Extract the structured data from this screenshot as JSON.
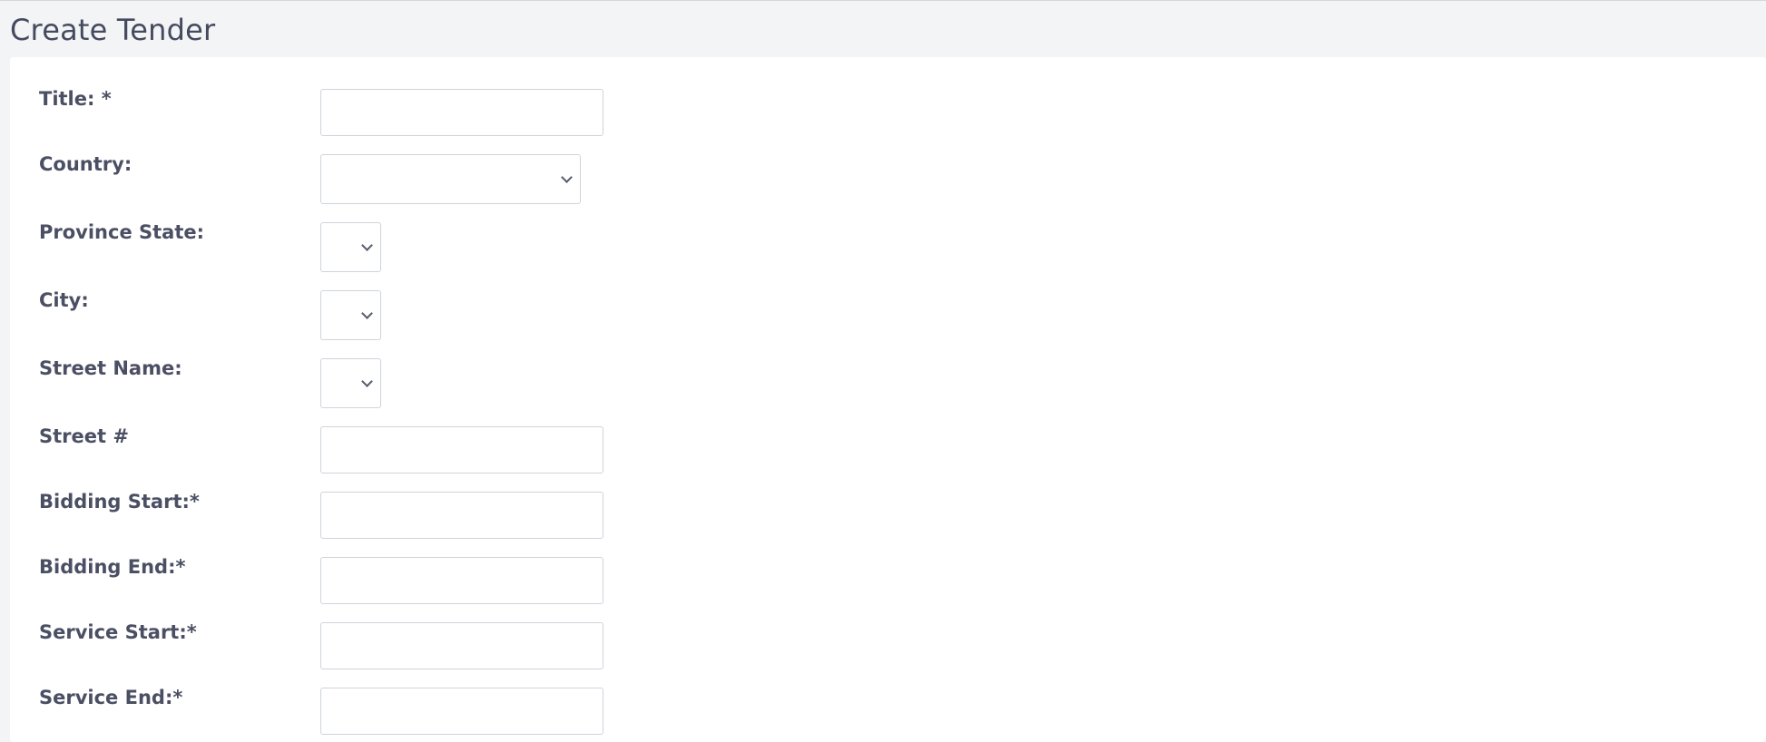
{
  "page": {
    "title": "Create Tender"
  },
  "form": {
    "fields": [
      {
        "id": "title",
        "label": "Title: *",
        "type": "text",
        "value": ""
      },
      {
        "id": "country",
        "label": "Country:",
        "type": "select",
        "value": ""
      },
      {
        "id": "province_state",
        "label": "Province State:",
        "type": "select",
        "value": ""
      },
      {
        "id": "city",
        "label": "City:",
        "type": "select",
        "value": ""
      },
      {
        "id": "street_name",
        "label": "Street Name:",
        "type": "select",
        "value": ""
      },
      {
        "id": "street_number",
        "label": "Street #",
        "type": "text",
        "value": ""
      },
      {
        "id": "bidding_start",
        "label": "Bidding Start:*",
        "type": "text",
        "value": ""
      },
      {
        "id": "bidding_end",
        "label": "Bidding End:*",
        "type": "text",
        "value": ""
      },
      {
        "id": "service_start",
        "label": "Service Start:*",
        "type": "text",
        "value": ""
      },
      {
        "id": "service_end",
        "label": "Service End:*",
        "type": "text",
        "value": ""
      }
    ]
  }
}
